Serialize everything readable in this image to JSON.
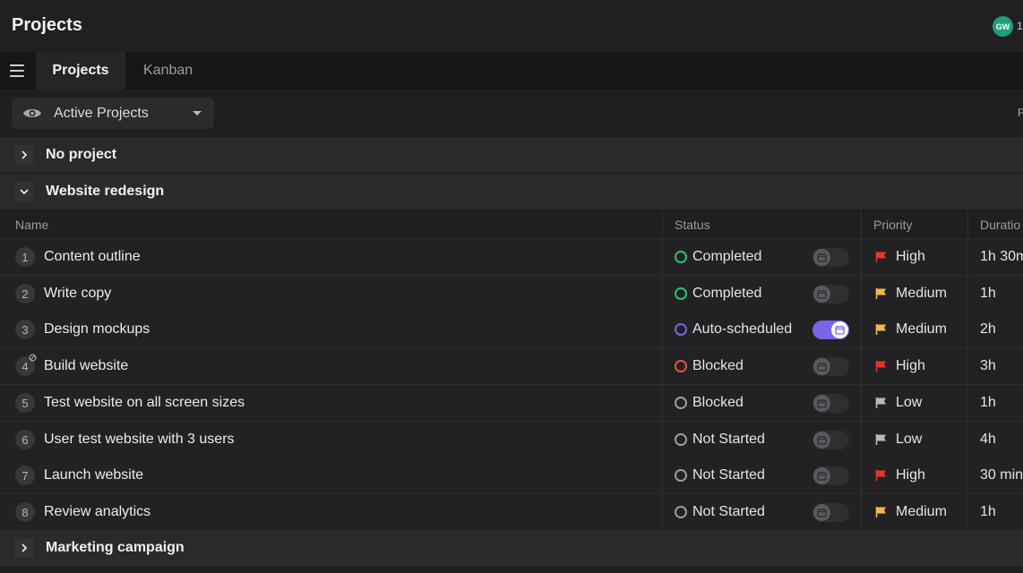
{
  "header": {
    "title": "Projects",
    "avatar_initials": "GW",
    "avatar_count_partial": "1"
  },
  "tabs": {
    "active": "Projects",
    "other": "Kanban"
  },
  "filter": {
    "label": "Active Projects",
    "right_cut_text": "F"
  },
  "groups": {
    "no_project": "No project",
    "website": "Website redesign",
    "marketing": "Marketing campaign"
  },
  "columns": {
    "name": "Name",
    "status": "Status",
    "priority": "Priority",
    "duration": "Duratio"
  },
  "tasks": [
    {
      "num": "1",
      "name": "Content outline",
      "status": "Completed",
      "status_color": "#2fbf71",
      "auto": false,
      "priority": "High",
      "flag_color": "#e5342e",
      "duration": "1h 30m"
    },
    {
      "num": "2",
      "name": "Write copy",
      "status": "Completed",
      "status_color": "#2fbf71",
      "auto": false,
      "priority": "Medium",
      "flag_color": "#f5b74a",
      "duration": "1h"
    },
    {
      "num": "3",
      "name": "Design mockups",
      "status": "Auto-scheduled",
      "status_color": "#7b63e6",
      "auto": true,
      "priority": "Medium",
      "flag_color": "#f5b74a",
      "duration": "2h"
    },
    {
      "num": "4",
      "name": "Build website",
      "status": "Blocked",
      "status_color": "#e5553e",
      "auto": false,
      "priority": "High",
      "flag_color": "#e5342e",
      "duration": "3h"
    },
    {
      "num": "5",
      "name": "Test website on all screen sizes",
      "status": "Blocked",
      "status_color": "#9b9ba0",
      "auto": false,
      "priority": "Low",
      "flag_color": "#b8b8bd",
      "duration": "1h"
    },
    {
      "num": "6",
      "name": "User test website with 3 users",
      "status": "Not Started",
      "status_color": "#9b9ba0",
      "auto": false,
      "priority": "Low",
      "flag_color": "#b8b8bd",
      "duration": "4h"
    },
    {
      "num": "7",
      "name": "Launch website",
      "status": "Not Started",
      "status_color": "#9b9ba0",
      "auto": false,
      "priority": "High",
      "flag_color": "#e5342e",
      "duration": "30 min"
    },
    {
      "num": "8",
      "name": "Review analytics",
      "status": "Not Started",
      "status_color": "#9b9ba0",
      "auto": false,
      "priority": "Medium",
      "flag_color": "#f5b74a",
      "duration": "1h"
    }
  ]
}
